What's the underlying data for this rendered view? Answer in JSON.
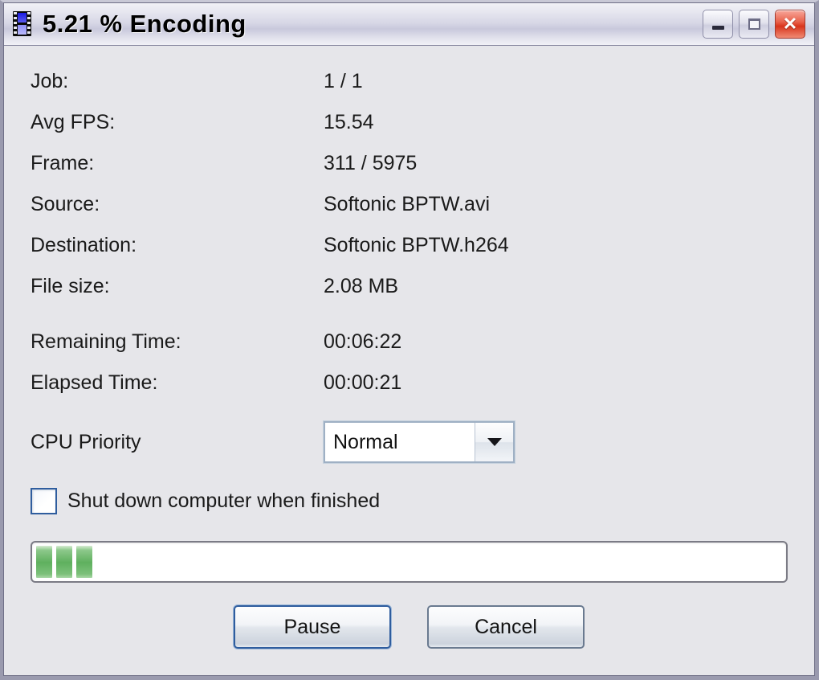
{
  "window": {
    "title": "5.21 % Encoding",
    "icon": "film-strip-icon",
    "controls": {
      "minimize": "–",
      "maximize": "□",
      "close": "✕"
    }
  },
  "info_rows": [
    {
      "label": "Job:",
      "value": "1 / 1"
    },
    {
      "label": "Avg FPS:",
      "value": "15.54"
    },
    {
      "label": "Frame:",
      "value": "311 / 5975"
    },
    {
      "label": "Source:",
      "value": "Softonic BPTW.avi"
    },
    {
      "label": "Destination:",
      "value": "Softonic BPTW.h264"
    },
    {
      "label": "File size:",
      "value": "2.08 MB"
    },
    {
      "label": "Remaining Time:",
      "value": "00:06:22"
    },
    {
      "label": "Elapsed Time:",
      "value": "00:00:21"
    }
  ],
  "cpu_priority": {
    "label": "CPU Priority",
    "value": "Normal",
    "options": [
      "Normal"
    ],
    "arrow_icon": "chevron-down-icon"
  },
  "shutdown": {
    "label": "Shut down computer when finished",
    "checked": false
  },
  "progress": {
    "percent": "5.21",
    "chunks": 3,
    "fill_color": "#5fb05e",
    "track_color": "#ffffff"
  },
  "buttons": {
    "pause": "Pause",
    "cancel": "Cancel"
  }
}
